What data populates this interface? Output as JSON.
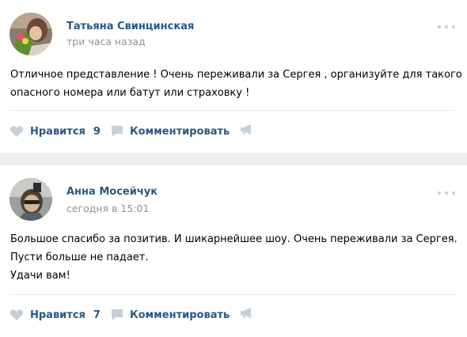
{
  "colors": {
    "link": "#2a5885",
    "meta": "#939393",
    "icon": "#c5d0db",
    "background": "#edeef0"
  },
  "posts": [
    {
      "author": "Татьяна Свинцинская",
      "time": "три часа назад",
      "text": [
        "Отличное представление ! Очень переживали за Сергея , организуйте для такого",
        "опасного номера или батут или страховку !"
      ],
      "like_label": "Нравится",
      "like_count": "9",
      "comment_label": "Комментировать",
      "icons": {
        "like": "heart-icon",
        "comment": "comment-icon",
        "share": "megaphone-icon",
        "more": "more-dots-icon"
      }
    },
    {
      "author": "Анна Мосейчук",
      "time": "сегодня в 15:01",
      "text": [
        "Большое спасибо за позитив. И шикарнейшее шоу. Очень переживали за Сергея.",
        "Пусти больше не падает.",
        "Удачи вам!"
      ],
      "like_label": "Нравится",
      "like_count": "7",
      "comment_label": "Комментировать",
      "icons": {
        "like": "heart-icon",
        "comment": "comment-icon",
        "share": "megaphone-icon",
        "more": "more-dots-icon"
      }
    }
  ]
}
